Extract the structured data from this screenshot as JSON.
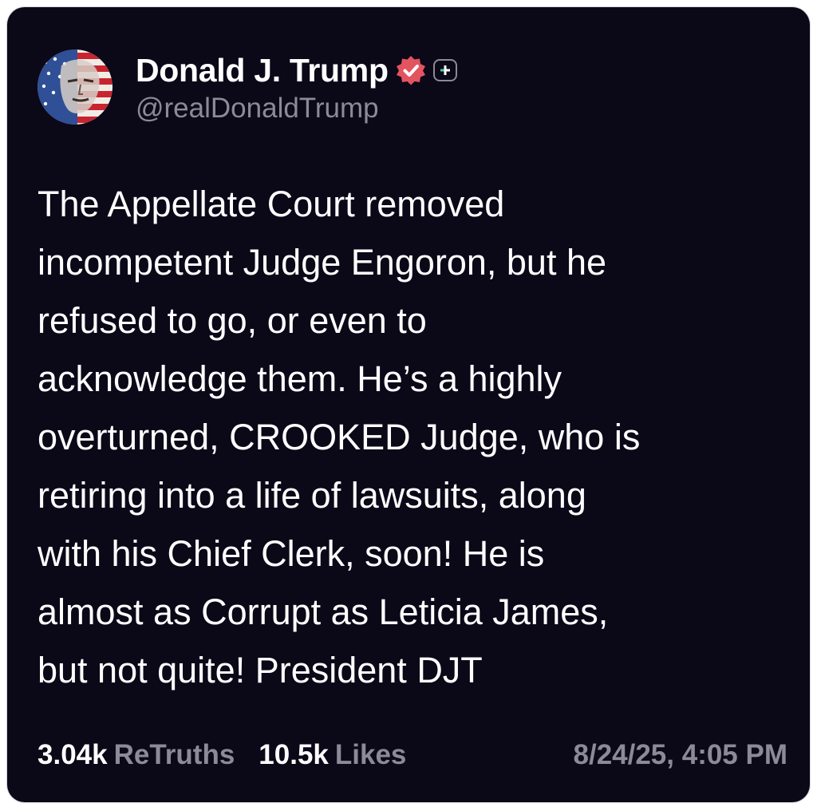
{
  "author": {
    "display_name": "Donald J. Trump",
    "handle": "@realDonaldTrump",
    "avatar_icon": "flag-portrait-avatar",
    "verified_icon": "verified-badge-icon",
    "verified_color": "#e2545f",
    "plus_icon": "plus-badge-icon"
  },
  "post": {
    "text": "The Appellate Court removed\nincompetent Judge Engoron, but he\nrefused to go, or even to\nacknowledge them. He’s a highly\noverturned, CROOKED Judge, who is\nretiring into a life of lawsuits, along\nwith his Chief Clerk, soon! He is\nalmost as Corrupt as Leticia James,\nbut not quite! President DJT"
  },
  "stats": {
    "retruths_count": "3.04k",
    "retruths_label": "ReTruths",
    "likes_count": "10.5k",
    "likes_label": "Likes",
    "timestamp": "8/24/25, 4:05 PM"
  },
  "colors": {
    "background": "#0b0818",
    "text": "#ffffff",
    "muted": "#8c8a99"
  }
}
